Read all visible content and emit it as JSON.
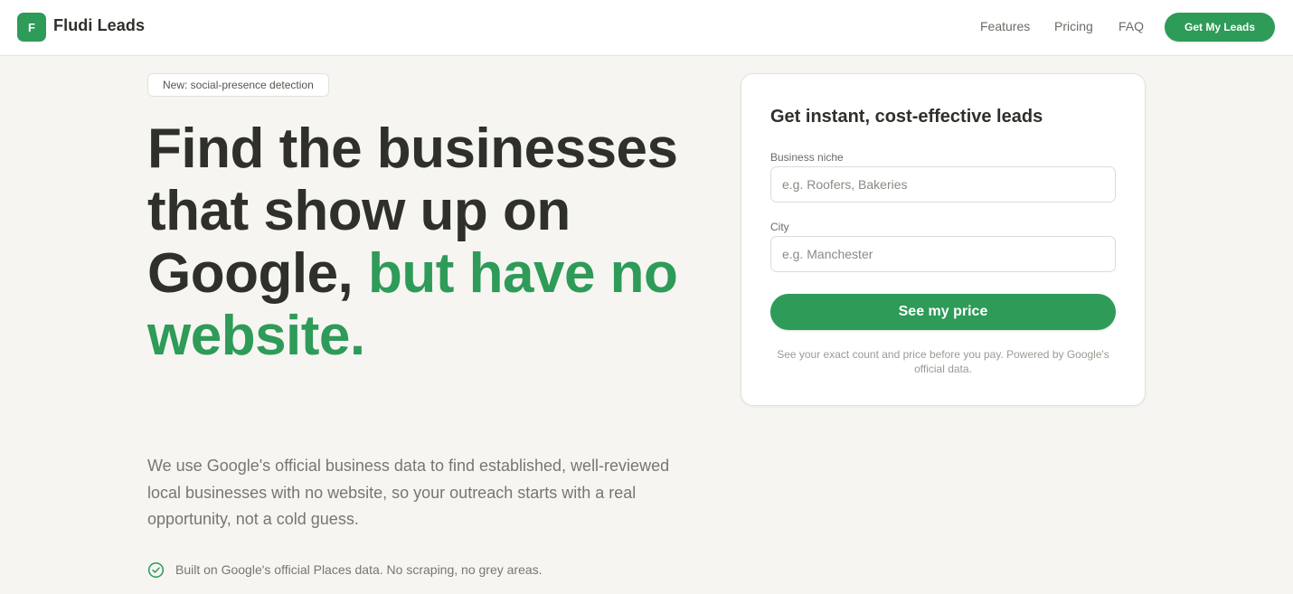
{
  "header": {
    "logo_letter": "F",
    "brand": "Fludi Leads",
    "nav": [
      "Features",
      "Pricing",
      "FAQ"
    ],
    "cta": "Get My Leads"
  },
  "hero": {
    "badge": "New: social-presence detection",
    "title_plain": "Find the businesses that show up on Google,",
    "title_accent": "but have no website.",
    "subtitle": "We use Google's official business data to find established, well-reviewed local businesses with no website, so your outreach starts with a real opportunity, not a cold guess.",
    "trust_note": "Built on Google's official Places data. No scraping, no grey areas."
  },
  "form": {
    "title": "Get instant, cost-effective leads",
    "niche_label": "Business niche",
    "niche_placeholder": "e.g. Roofers, Bakeries",
    "city_label": "City",
    "city_placeholder": "e.g. Manchester",
    "submit": "See my price",
    "note": "See your exact count and price before you pay. Powered by Google's official data."
  },
  "colors": {
    "accent": "#2e9b58",
    "background": "#f6f5f1",
    "text": "#2f2f2b",
    "muted": "#77776f"
  },
  "icons": {
    "trust": "check-circle-icon"
  }
}
